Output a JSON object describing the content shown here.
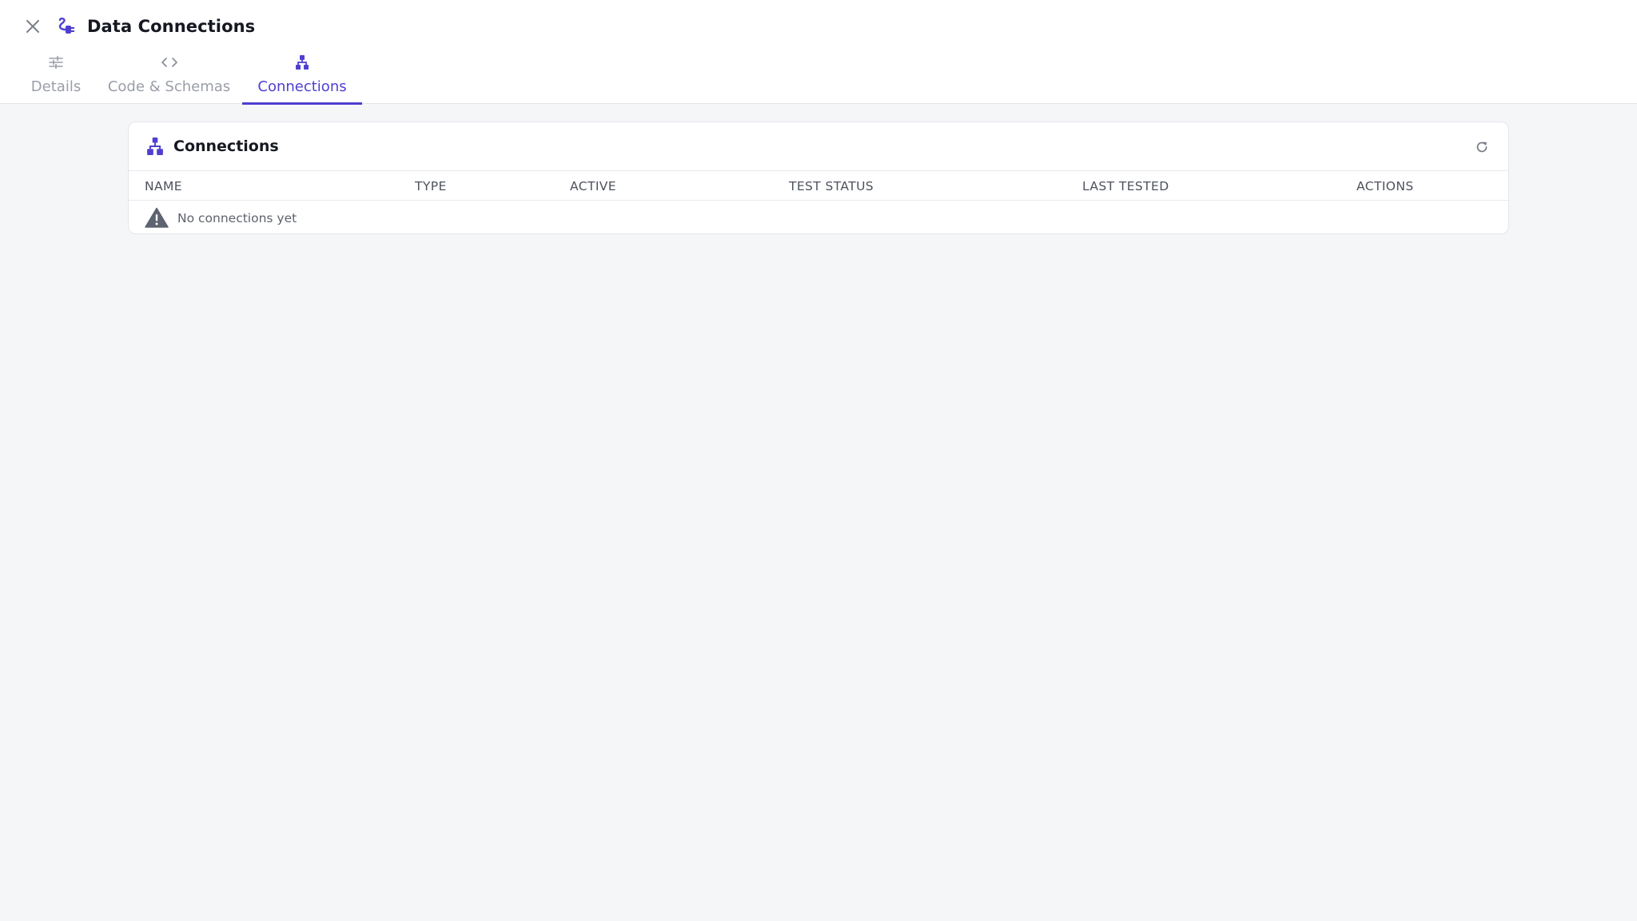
{
  "header": {
    "title": "Data Connections",
    "close_icon": "close-icon",
    "app_icon": "plug-icon"
  },
  "tabs": [
    {
      "label": "Details",
      "icon": "sliders-icon",
      "active": false
    },
    {
      "label": "Code & Schemas",
      "icon": "code-icon",
      "active": false
    },
    {
      "label": "Connections",
      "icon": "hierarchy-icon",
      "active": true
    }
  ],
  "card": {
    "title": "Connections",
    "icon": "hierarchy-icon",
    "refresh_icon": "refresh-icon"
  },
  "table": {
    "columns": [
      "NAME",
      "TYPE",
      "ACTIVE",
      "TEST STATUS",
      "LAST TESTED",
      "ACTIONS"
    ],
    "rows": [],
    "empty_message": "No connections yet",
    "empty_icon": "warning-icon"
  },
  "colors": {
    "accent": "#4f3fd1",
    "background": "#f5f6f8",
    "card": "#ffffff",
    "border": "#e4e6eb",
    "muted_text": "#9a9ea8",
    "warning_icon": "#5d6370"
  }
}
